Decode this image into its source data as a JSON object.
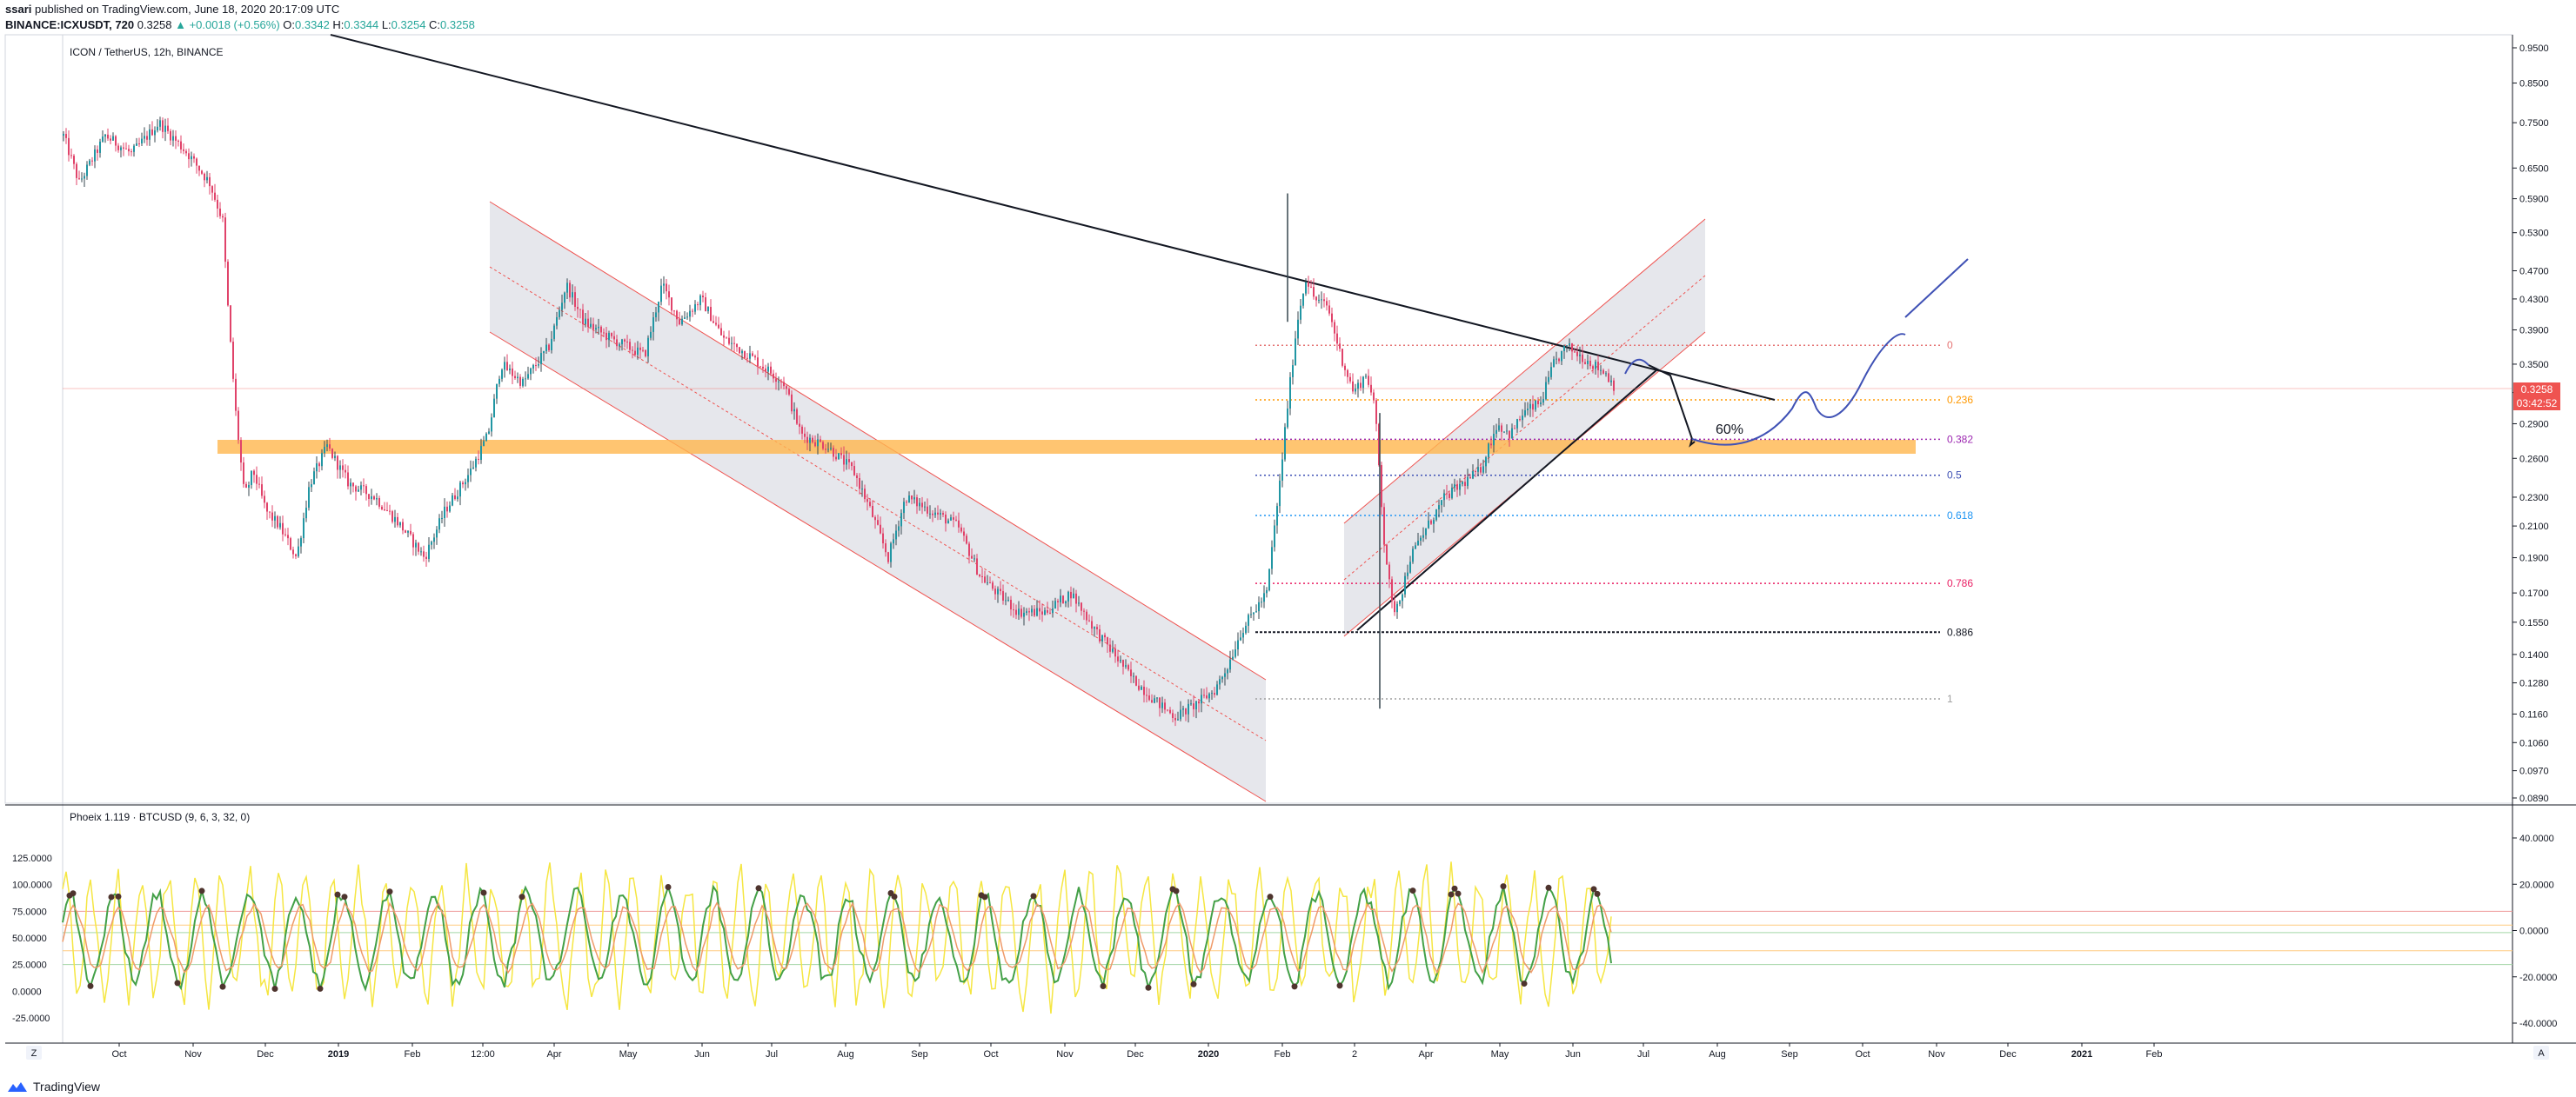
{
  "header": {
    "author": "ssari",
    "published": "published on TradingView.com, June 18, 2020 20:17:09 UTC",
    "symbol": "BINANCE:ICXUSDT, 720",
    "last": "0.3258",
    "change": "▲ +0.0018 (+0.56%)",
    "o_label": "O:",
    "o_value": "0.3342",
    "h_label": "H:",
    "h_value": "0.3344",
    "l_label": "L:",
    "l_value": "0.3254",
    "c_label": "C:",
    "c_value": "0.3258"
  },
  "main_pane": {
    "title": "ICON / TetherUS, 12h, BINANCE",
    "price_tag": "0.3258",
    "countdown": "03:42:52",
    "annotation": "60%",
    "y_ticks": [
      "0.9500",
      "0.8500",
      "0.7500",
      "0.6500",
      "0.5900",
      "0.5300",
      "0.4700",
      "0.4300",
      "0.3900",
      "0.3500",
      "0.3200",
      "0.2900",
      "0.2600",
      "0.2300",
      "0.2100",
      "0.1900",
      "0.1700",
      "0.1550",
      "0.1400",
      "0.1280",
      "0.1160",
      "0.1060",
      "0.0970",
      "0.0890"
    ]
  },
  "fib_levels": [
    {
      "label": "0",
      "price": 0.3715,
      "color": "#e57373"
    },
    {
      "label": "0.236",
      "price": 0.3127,
      "color": "#ff9800"
    },
    {
      "label": "0.382",
      "price": 0.2761,
      "color": "#9c27b0"
    },
    {
      "label": "0.5",
      "price": 0.2465,
      "color": "#3f51b5"
    },
    {
      "label": "0.618",
      "price": 0.2171,
      "color": "#2196f3"
    },
    {
      "label": "0.786",
      "price": 0.1752,
      "color": "#e91e63"
    },
    {
      "label": "0.886",
      "price": 0.1502,
      "color": "#131722"
    },
    {
      "label": "1",
      "price": 0.1217,
      "color": "#9e9e9e"
    }
  ],
  "indicator_pane": {
    "title": "Phoeix 1.119 · BTCUSD (9, 6, 3, 32, 0)",
    "left_ticks": [
      "125.0000",
      "100.0000",
      "75.0000",
      "50.0000",
      "25.0000",
      "0.0000",
      "-25.0000"
    ],
    "right_ticks": [
      "40.0000",
      "20.0000",
      "0.0000",
      "-20.0000",
      "-40.0000"
    ]
  },
  "time_axis": {
    "labels": [
      "Oct",
      "Nov",
      "Dec",
      "2019",
      "Feb",
      "12:00",
      "Apr",
      "May",
      "Jun",
      "Jul",
      "Aug",
      "Sep",
      "Oct",
      "Nov",
      "Dec",
      "2020",
      "Feb",
      "2",
      "Apr",
      "May",
      "Jun",
      "Jul",
      "Aug",
      "Sep",
      "Oct",
      "Nov",
      "Dec",
      "2021",
      "Feb"
    ],
    "left_button": "Z",
    "right_button": "A"
  },
  "footer": {
    "brand": "TradingView"
  },
  "chart_data": {
    "type": "candlestick",
    "title": "ICON / TetherUS, 12h, BINANCE",
    "scale": "log",
    "ylim": [
      0.089,
      0.95
    ],
    "x_range": [
      "2018-09",
      "2021-03"
    ],
    "series": [
      {
        "name": "ICXUSDT",
        "approx_closes": [
          {
            "x": "2018-09",
            "y": 0.7
          },
          {
            "x": "2018-10",
            "y": 0.68
          },
          {
            "x": "2018-11",
            "y": 0.6
          },
          {
            "x": "2018-12",
            "y": 0.21
          },
          {
            "x": "2019-01",
            "y": 0.26
          },
          {
            "x": "2019-02",
            "y": 0.2
          },
          {
            "x": "2019-03",
            "y": 0.34
          },
          {
            "x": "2019-04",
            "y": 0.44
          },
          {
            "x": "2019-05",
            "y": 0.39
          },
          {
            "x": "2019-06",
            "y": 0.4
          },
          {
            "x": "2019-07",
            "y": 0.31
          },
          {
            "x": "2019-08",
            "y": 0.24
          },
          {
            "x": "2019-09",
            "y": 0.2
          },
          {
            "x": "2019-10",
            "y": 0.17
          },
          {
            "x": "2019-11",
            "y": 0.15
          },
          {
            "x": "2019-12",
            "y": 0.12
          },
          {
            "x": "2020-01",
            "y": 0.14
          },
          {
            "x": "2020-02",
            "y": 0.43
          },
          {
            "x": "2020-03",
            "y": 0.16
          },
          {
            "x": "2020-04",
            "y": 0.24
          },
          {
            "x": "2020-05",
            "y": 0.29
          },
          {
            "x": "2020-06",
            "y": 0.3258
          }
        ]
      }
    ]
  }
}
